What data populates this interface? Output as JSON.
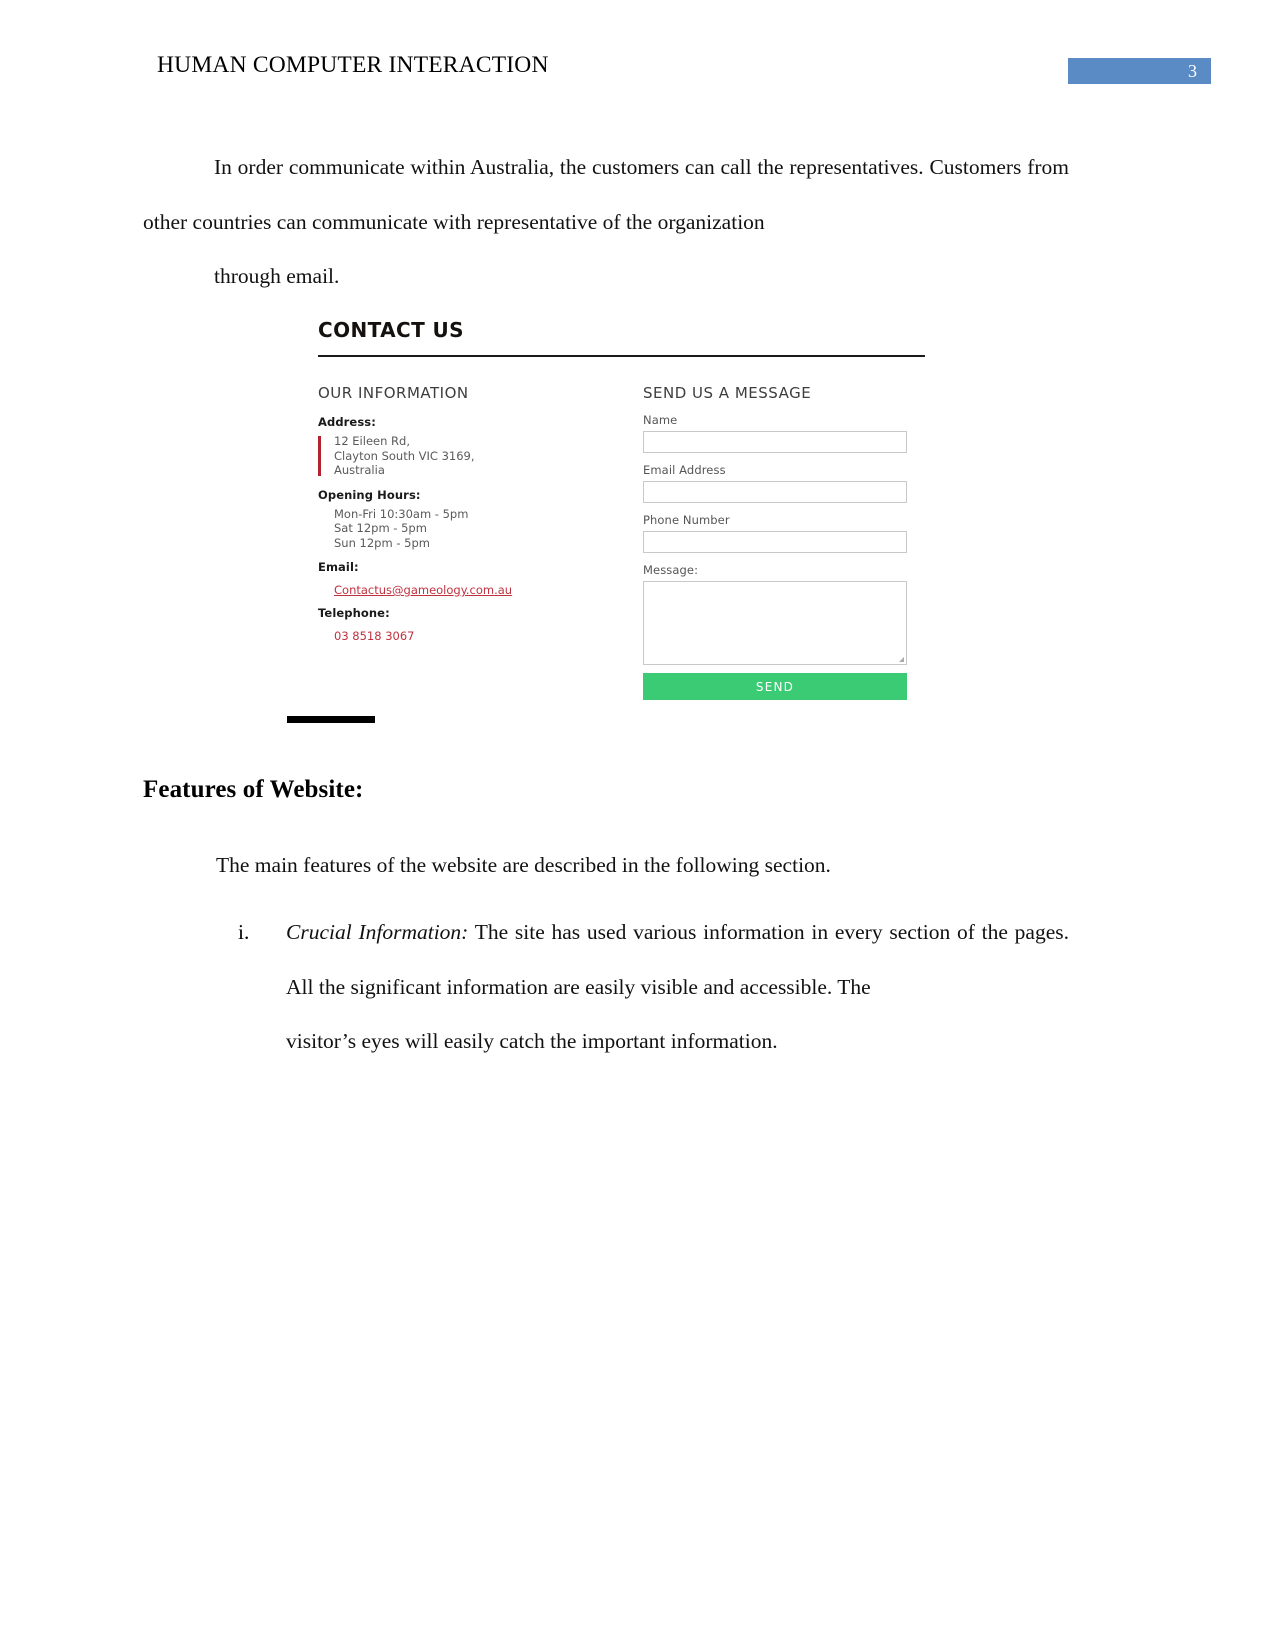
{
  "header": {
    "title": "HUMAN COMPUTER INTERACTION",
    "page_number": "3",
    "badge_color": "#5b8bc4"
  },
  "body": {
    "intro_paragraph": "In order communicate within Australia, the customers can call the representatives. Customers from other countries can communicate with representative of the organization",
    "intro_last_line": "through email.",
    "features_heading": "Features of Website:",
    "features_intro": "The main features of the website are described in the following section.",
    "list": [
      {
        "marker": "i.",
        "term": "Crucial Information:",
        "text": "The site has used various information in every section of the pages. All the significant information are easily visible and accessible. The",
        "last_line": "visitor’s eyes will easily catch the important information."
      }
    ]
  },
  "embedded_screenshot": {
    "title": "CONTACT US",
    "information": {
      "heading": "OUR INFORMATION",
      "address_label": "Address:",
      "address_lines": [
        "12 Eileen Rd,",
        "Clayton South VIC 3169,",
        "Australia"
      ],
      "hours_label": "Opening Hours:",
      "hours_lines": [
        "Mon-Fri 10:30am - 5pm",
        "Sat 12pm - 5pm",
        "Sun 12pm - 5pm"
      ],
      "email_label": "Email:",
      "email_value": "Contactus@gameology.com.au",
      "telephone_label": "Telephone:",
      "telephone_value": "03 8518 3067",
      "accent_color": "#b3232f",
      "link_color": "#c0313f"
    },
    "form": {
      "heading": "SEND US A MESSAGE",
      "name_label": "Name",
      "name_value": "",
      "email_label": "Email Address",
      "email_value": "",
      "phone_label": "Phone Number",
      "phone_value": "",
      "message_label": "Message:",
      "message_value": "",
      "send_label": "SEND",
      "send_color": "#3bcb74"
    }
  }
}
